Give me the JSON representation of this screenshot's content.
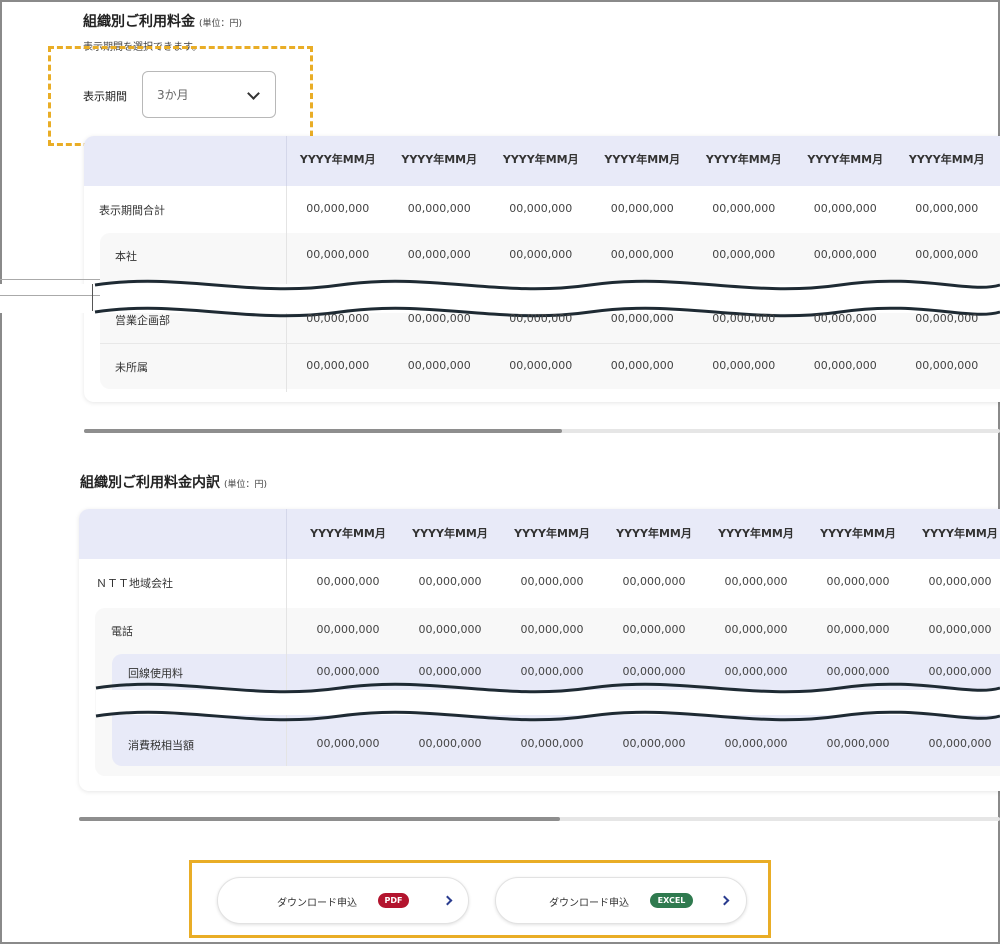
{
  "section1": {
    "title": "組織別ご利用料金",
    "unit": "(単位：円)",
    "hint": "表示期間を選択できます。",
    "period_label": "表示期間",
    "period_value": "3か月",
    "headers": [
      "YYYY年MM月",
      "YYYY年MM月",
      "YYYY年MM月",
      "YYYY年MM月",
      "YYYY年MM月",
      "YYYY年MM月",
      "YYYY年MM月"
    ],
    "rows": [
      {
        "label": "表示期間合計",
        "values": [
          "00,000,000",
          "00,000,000",
          "00,000,000",
          "00,000,000",
          "00,000,000",
          "00,000,000",
          "00,000,000"
        ]
      },
      {
        "label": "本社",
        "values": [
          "00,000,000",
          "00,000,000",
          "00,000,000",
          "00,000,000",
          "00,000,000",
          "00,000,000",
          "00,000,000"
        ]
      },
      {
        "label": "営業企画部",
        "values": [
          "00,000,000",
          "00,000,000",
          "00,000,000",
          "00,000,000",
          "00,000,000",
          "00,000,000",
          "00,000,000"
        ]
      },
      {
        "label": "未所属",
        "values": [
          "00,000,000",
          "00,000,000",
          "00,000,000",
          "00,000,000",
          "00,000,000",
          "00,000,000",
          "00,000,000"
        ]
      }
    ]
  },
  "section2": {
    "title": "組織別ご利用料金内訳",
    "unit": "(単位：円)",
    "headers": [
      "YYYY年MM月",
      "YYYY年MM月",
      "YYYY年MM月",
      "YYYY年MM月",
      "YYYY年MM月",
      "YYYY年MM月",
      "YYYY年MM月"
    ],
    "rows": [
      {
        "label": "ＮＴＴ地域会社",
        "values": [
          "00,000,000",
          "00,000,000",
          "00,000,000",
          "00,000,000",
          "00,000,000",
          "00,000,000",
          "00,000,000"
        ]
      },
      {
        "label": "電話",
        "values": [
          "00,000,000",
          "00,000,000",
          "00,000,000",
          "00,000,000",
          "00,000,000",
          "00,000,000",
          "00,000,000"
        ]
      },
      {
        "label": "回線使用料",
        "values": [
          "00,000,000",
          "00,000,000",
          "00,000,000",
          "00,000,000",
          "00,000,000",
          "00,000,000",
          "00,000,000"
        ]
      },
      {
        "label": "消費税相当額",
        "values": [
          "00,000,000",
          "00,000,000",
          "00,000,000",
          "00,000,000",
          "00,000,000",
          "00,000,000",
          "00,000,000"
        ]
      }
    ]
  },
  "downloads": {
    "pdf_label": "ダウンロード申込",
    "pdf_badge": "PDF",
    "excel_label": "ダウンロード申込",
    "excel_badge": "EXCEL"
  },
  "colors": {
    "header_bg": "#e8eaf8",
    "highlight": "#e9ad26",
    "pdf_badge": "#b3142e",
    "excel_badge": "#2f7a4f",
    "arrow": "#2a3c8f"
  },
  "icons": {
    "select_chevron": "chevron-down-icon",
    "button_arrow": "chevron-right-icon"
  }
}
